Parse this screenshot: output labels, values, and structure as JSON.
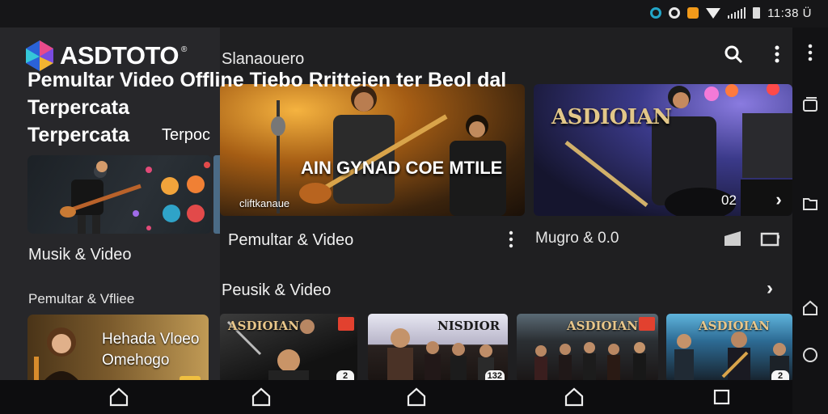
{
  "status_bar": {
    "time": "11:38 Ü",
    "icons": [
      "app-icon-cyan",
      "circle-app-icon",
      "orange-app-icon",
      "wifi-icon",
      "signal-icon",
      "battery-icon"
    ]
  },
  "drawer": {
    "logo_text": "ASDTOTO",
    "logo_mark": "®",
    "headline": "Pemultar Video Offline Tiebo Rritteien ter Beol dal Terpercata",
    "headline_line2": "Terpoc",
    "card1_label": "Musik & Video",
    "card2_heading": "Pemultar & Vfliee",
    "card2_text": "Hehada Vloeo Omehogo"
  },
  "main": {
    "app_title": "Slanaouero",
    "hero1": {
      "sign_text": "AIN GYNAD COE MTILE",
      "caption": "cliftkanaue"
    },
    "hero2": {
      "sign_text": "ASDIOIAN",
      "counter": "02"
    },
    "row_left_title": "Pemultar & Video",
    "row_right_title": "Mugro & 0.0",
    "section_title": "Peusik & Video",
    "thumbs": [
      {
        "sign": "ASDIOIAN",
        "count": "2"
      },
      {
        "sign": "NISDIOR",
        "count": "132"
      },
      {
        "sign": "ASDIOIAN",
        "count": ""
      },
      {
        "sign": "ASDIOIAN",
        "count": "2"
      }
    ]
  },
  "colors": {
    "background": "#1f1f21",
    "drawer": "#27272a",
    "accent_orange": "#f29a1a",
    "badge_red": "#e2412f"
  }
}
